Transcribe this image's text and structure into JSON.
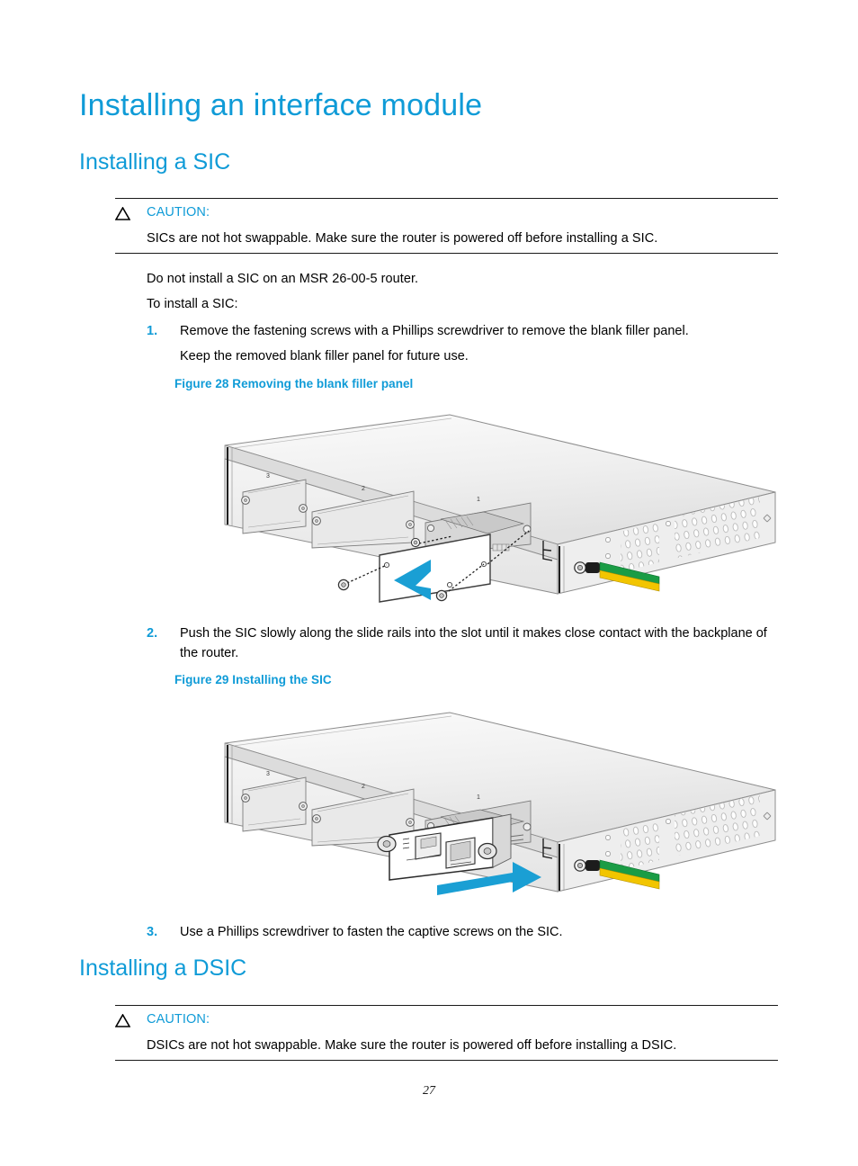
{
  "document": {
    "page_number": "27",
    "accent_color": "#0f9bd7",
    "text_color": "#000000"
  },
  "headings": {
    "h1": "Installing an interface module",
    "h2_sic": "Installing a SIC",
    "h2_dsic": "Installing a DSIC"
  },
  "caution_sic": {
    "icon": "caution-triangle-icon",
    "label": "CAUTION:",
    "text": "SICs are not hot swappable. Make sure the router is powered off before installing a SIC."
  },
  "caution_dsic": {
    "icon": "caution-triangle-icon",
    "label": "CAUTION:",
    "text": "DSICs are not hot swappable. Make sure the router is powered off before installing a DSIC."
  },
  "paragraphs": {
    "no_install": "Do not install a SIC on an MSR 26-00-5 router.",
    "to_install": "To install a SIC:"
  },
  "steps": [
    {
      "num": "1.",
      "text": "Remove the fastening screws with a Phillips screwdriver to remove the blank filler panel.",
      "sub": "Keep the removed blank filler panel for future use."
    },
    {
      "num": "2.",
      "text": "Push the SIC slowly along the slide rails into the slot until it makes close contact with the backplane of the router.",
      "sub": ""
    },
    {
      "num": "3.",
      "text": "Use a Phillips screwdriver to fasten the captive screws on the SIC.",
      "sub": ""
    }
  ],
  "figures": [
    {
      "caption": "Figure 28 Removing the blank filler panel",
      "slot_labels": [
        "3",
        "2",
        "1"
      ],
      "arrow_color": "#1a9fd4",
      "ground_cable_colors": [
        "#1a9c45",
        "#f2c500"
      ],
      "chassis_color": "#ededed"
    },
    {
      "caption": "Figure 29 Installing the SIC",
      "slot_labels": [
        "3",
        "2",
        "1"
      ],
      "arrow_color": "#1a9fd4",
      "ground_cable_colors": [
        "#1a9c45",
        "#f2c500"
      ],
      "chassis_color": "#ededed"
    }
  ]
}
